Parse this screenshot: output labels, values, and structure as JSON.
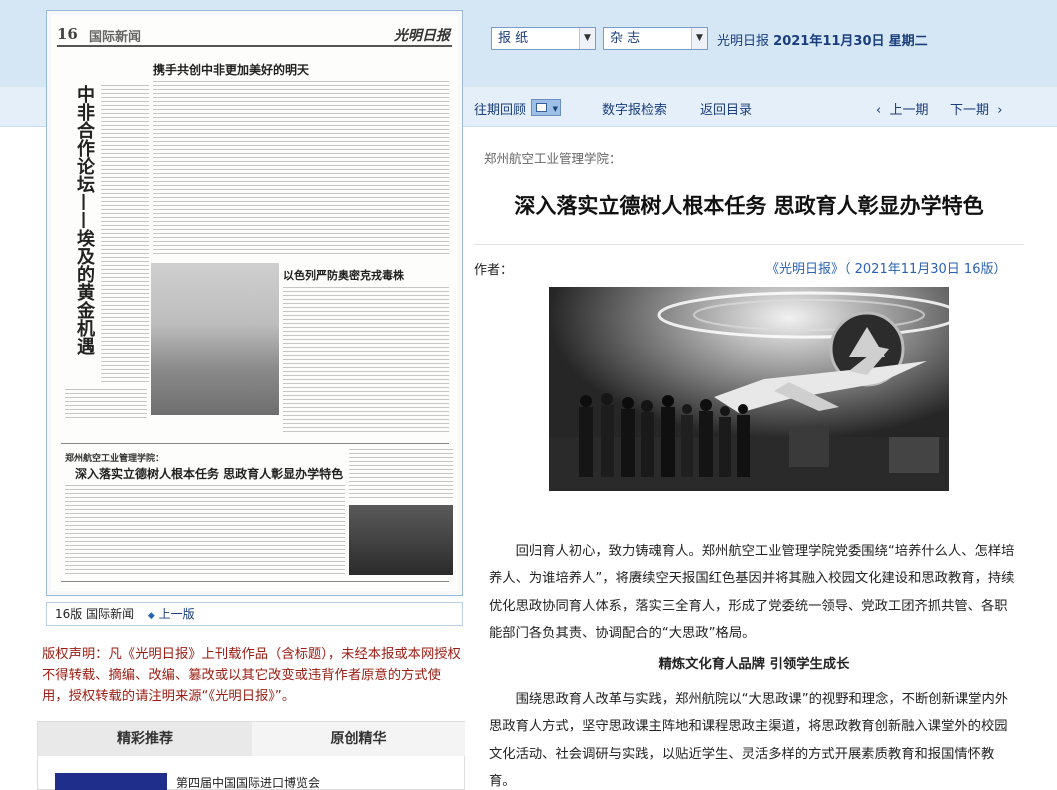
{
  "header": {
    "select_newspaper": "报  纸",
    "select_magazine": "杂  志",
    "paper_name": "光明日报",
    "date": "2021年11月30日",
    "weekday": "星期二"
  },
  "nav": {
    "archive": "往期回顾",
    "search": "数字报检索",
    "index": "返回目录",
    "prev_issue": "上一期",
    "next_issue": "下一期"
  },
  "paper_page": {
    "page_num": "16",
    "section": "国际新闻",
    "masthead": "光明日报",
    "vertical_headline": "中非合作论坛——埃及的黄金机遇",
    "headline_1": "携手共创中非更加美好的明天",
    "headline_2": "以色列严防奥密克戎毒株",
    "headline_3_lead": "郑州航空工业管理学院：",
    "headline_3": "深入落实立德树人根本任务  思政育人彰显办学特色"
  },
  "page_caption": {
    "label": "16版 国际新闻",
    "prev": "上一版"
  },
  "copyright": "版权声明：凡《光明日报》上刊载作品（含标题），未经本报或本网授权不得转载、摘编、改编、篡改或以其它改变或违背作者原意的方式使用，授权转载的请注明来源“《光明日报》”。",
  "tabs": {
    "recommended": "精彩推荐",
    "original": "原创精华"
  },
  "recommend_items": [
    "第四届中国国际进口博览会"
  ],
  "article": {
    "source_line": "郑州航空工业管理学院：",
    "title": "深入落实立德树人根本任务  思政育人彰显办学特色",
    "author_label": "作者：",
    "paper_ref": "《光明日报》（ 2021年11月30日   16版）",
    "paragraph_1": "回归育人初心，致力铸魂育人。郑州航空工业管理学院党委围绕“培养什么人、怎样培养人、为谁培养人”，将赓续空天报国红色基因并将其融入校园文化建设和思政教育，持续优化思政协同育人体系，落实三全育人，形成了党委统一领导、党政工团齐抓共管、各职能部门各负其责、协调配合的“大思政”格局。",
    "subheading": "精炼文化育人品牌    引领学生成长",
    "paragraph_2": "围绕思政育人改革与实践，郑州航院以“大思政课”的视野和理念，不断创新课堂内外思政育人方式，坚守思政课主阵地和课程思政主渠道，将思政教育创新融入课堂外的校园文化活动、社会调研与实践，以贴近学生、灵活多样的方式开展素质教育和报国情怀教育。"
  },
  "colors": {
    "link_blue": "#1a3d7c",
    "copyright_red": "#9b1c12",
    "band_blue": "#d5e6f5"
  }
}
